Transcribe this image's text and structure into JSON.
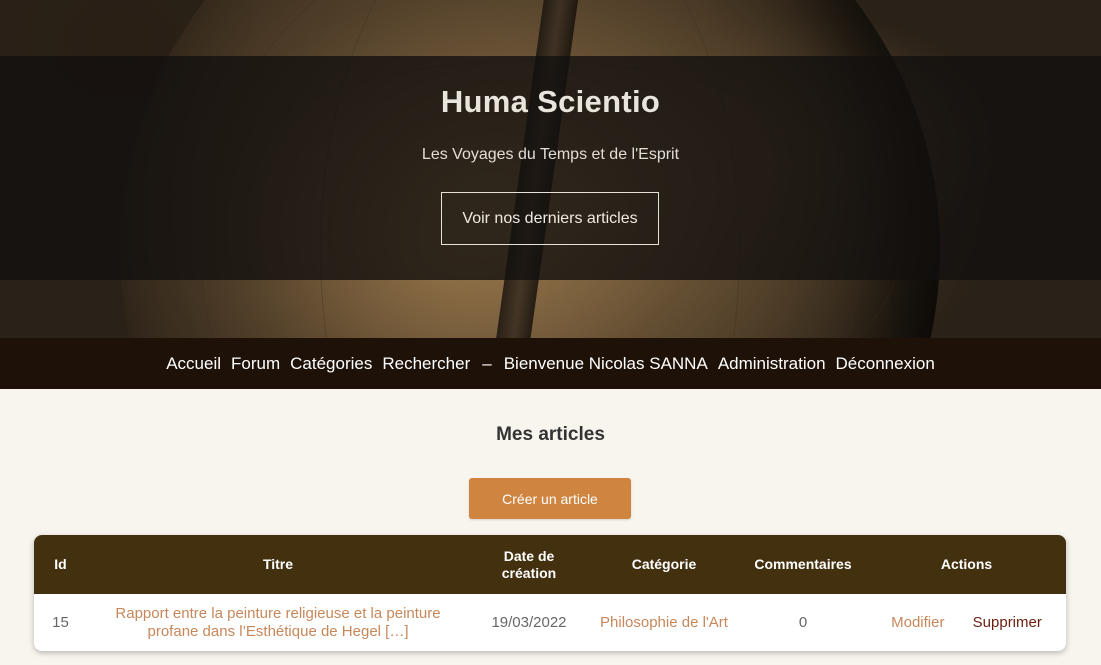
{
  "hero": {
    "title": "Huma Scientio",
    "tagline": "Les Voyages du Temps et de l'Esprit",
    "button_label": "Voir nos derniers articles"
  },
  "nav": {
    "items": [
      "Accueil",
      "Forum",
      "Catégories",
      "Rechercher"
    ],
    "separator": "–",
    "welcome": "Bienvenue Nicolas SANNA",
    "admin": "Administration",
    "logout": "Déconnexion"
  },
  "main": {
    "title": "Mes articles",
    "create_button": "Créer un article"
  },
  "table": {
    "headers": {
      "id": "Id",
      "title": "Titre",
      "date": "Date de création",
      "category": "Catégorie",
      "comments": "Commentaires",
      "actions": "Actions"
    },
    "rows": [
      {
        "id": "15",
        "title": "Rapport entre la peinture religieuse et la peinture profane dans l’Esthétique de Hegel […]",
        "date": "19/03/2022",
        "category": "Philosophie de l'Art",
        "comments": "0",
        "edit": "Modifier",
        "delete": "Supprimer"
      }
    ]
  },
  "colors": {
    "accent": "#cf853f",
    "nav_bg": "#1d1108",
    "table_header_bg": "#43300f",
    "link": "#c7875a",
    "delete_link": "#6a1f0f"
  }
}
